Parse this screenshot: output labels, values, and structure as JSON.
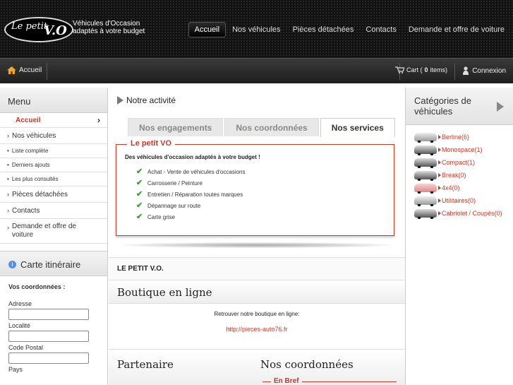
{
  "header": {
    "logo_prefix": "Le petit",
    "logo_vo": "V.O",
    "logo_tagline_line1": "Véhicules d'Occasion",
    "logo_tagline_line2": "adaptés à votre budget",
    "nav": [
      {
        "label": "Accueil",
        "active": true
      },
      {
        "label": "Nos véhicules"
      },
      {
        "label": "Pièces détachées"
      },
      {
        "label": "Contacts"
      },
      {
        "label": "Demande et offre de voiture"
      }
    ]
  },
  "subbar": {
    "home_label": "Accueil",
    "cart_prefix": "Cart (",
    "cart_count": "0",
    "cart_suffix": " items)",
    "login_label": "Connexion"
  },
  "left": {
    "menu_title": "Menu",
    "items": [
      {
        "label": "Accueil"
      },
      {
        "label": "Nos véhicules"
      },
      {
        "label": "Liste complète"
      },
      {
        "label": "Derniers ajouts"
      },
      {
        "label": "Les plus consultés"
      },
      {
        "label": "Pièces détachées"
      },
      {
        "label": "Contacts"
      },
      {
        "label": "Demande et offre de voiture"
      }
    ],
    "carte_title": "Carte itinéraire",
    "coords_title": "Vos coordonnées :",
    "fields": [
      "Adresse",
      "Localité",
      "Code Postal",
      "Pays"
    ]
  },
  "center": {
    "activity_title": "Notre activité",
    "tabs": [
      "Nos engagements",
      "Nos coordonnées",
      "Nos services"
    ],
    "box_title": "Le petit VO",
    "box_intro": "Des véhicules d'occasion adaptés à votre budget !",
    "services": [
      "Achat - Vente de véhicules d'occasions",
      "Carrosserie / Peinture",
      "Entretien / Réparation toutes marques",
      "Dépannage sur route",
      "Carte grise"
    ],
    "lepetit_heading": "LE PETIT V.O.",
    "boutique_heading": "Boutique en ligne",
    "boutique_text": "Retrouver notre boutique en ligne:",
    "boutique_link": "http://pieces-auto76.fr",
    "partenaire_heading": "Partenaire",
    "coordonnees_heading": "Nos coordonnées",
    "enbref_label": "En Bref"
  },
  "right": {
    "title": "Catégories de véhicules",
    "categories": [
      {
        "label": "Berline(6)"
      },
      {
        "label": "Monospace(1)"
      },
      {
        "label": "Compact(1)"
      },
      {
        "label": "Break(0)"
      },
      {
        "label": "4x4(0)"
      },
      {
        "label": "Utilitaires(0)"
      },
      {
        "label": "Cabriolet / Coupés(0)"
      }
    ]
  },
  "colors": {
    "accent_red": "#c0392b",
    "header_bg": "#111111",
    "check_green": "#3e9a3e"
  }
}
